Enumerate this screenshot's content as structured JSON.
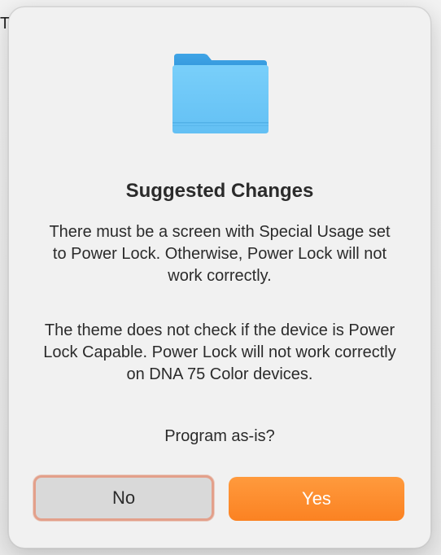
{
  "background": {
    "partial_char": "T"
  },
  "dialog": {
    "icon": "folder-icon",
    "title": "Suggested Changes",
    "message_1": "There must be a screen with Special Usage set to Power Lock. Otherwise, Power Lock will not work correctly.",
    "message_2": "The theme does not check if the device is Power Lock Capable. Power Lock will not work correctly on DNA 75 Color devices.",
    "prompt": "Program as-is?",
    "buttons": {
      "no_label": "No",
      "yes_label": "Yes"
    }
  },
  "colors": {
    "folder": "#6cc7f8",
    "accent": "#fb8a2a",
    "focus_ring": "#e3a08b"
  }
}
